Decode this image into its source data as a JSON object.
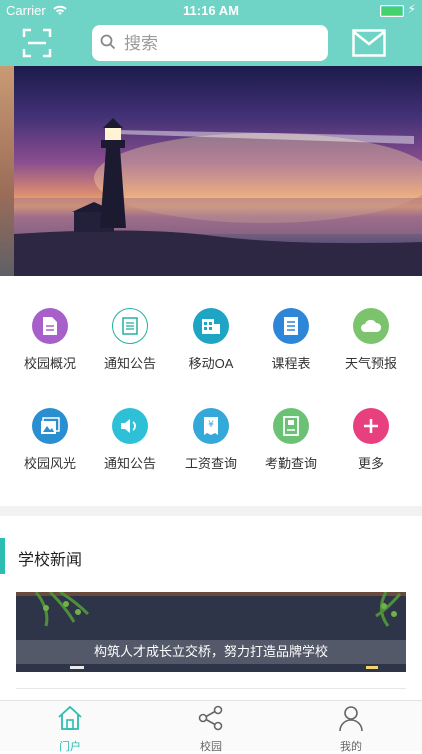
{
  "status_bar": {
    "carrier": "Carrier",
    "time": "11:16 AM"
  },
  "header": {
    "search_placeholder": "搜索"
  },
  "grid": [
    {
      "label": "校园概况",
      "icon": "document-icon",
      "color": "#a760c9"
    },
    {
      "label": "通知公告",
      "icon": "notice-list-icon",
      "color": "#24b0a2"
    },
    {
      "label": "移动OA",
      "icon": "building-icon",
      "color": "#1fa5c4"
    },
    {
      "label": "课程表",
      "icon": "schedule-icon",
      "color": "#2e86d8"
    },
    {
      "label": "天气预报",
      "icon": "cloud-icon",
      "color": "#7cc36d"
    },
    {
      "label": "校园风光",
      "icon": "gallery-icon",
      "color": "#2a8fd0"
    },
    {
      "label": "通知公告",
      "icon": "speaker-icon",
      "color": "#2ec0d6"
    },
    {
      "label": "工资查询",
      "icon": "receipt-yen-icon",
      "color": "#34a8d8"
    },
    {
      "label": "考勤查询",
      "icon": "attendance-icon",
      "color": "#6bc274"
    },
    {
      "label": "更多",
      "icon": "plus-icon",
      "color": "#e83f7e"
    }
  ],
  "section": {
    "title": "学校新闻"
  },
  "news": {
    "caption": "构筑人才成长立交桥，努力打造品牌学校"
  },
  "tabbar": [
    {
      "label": "门户",
      "icon": "home-icon",
      "active": true,
      "color": "#2bbdb0"
    },
    {
      "label": "校园",
      "icon": "share-icon",
      "active": false,
      "color": "#666666"
    },
    {
      "label": "我的",
      "icon": "person-icon",
      "active": false,
      "color": "#666666"
    }
  ]
}
